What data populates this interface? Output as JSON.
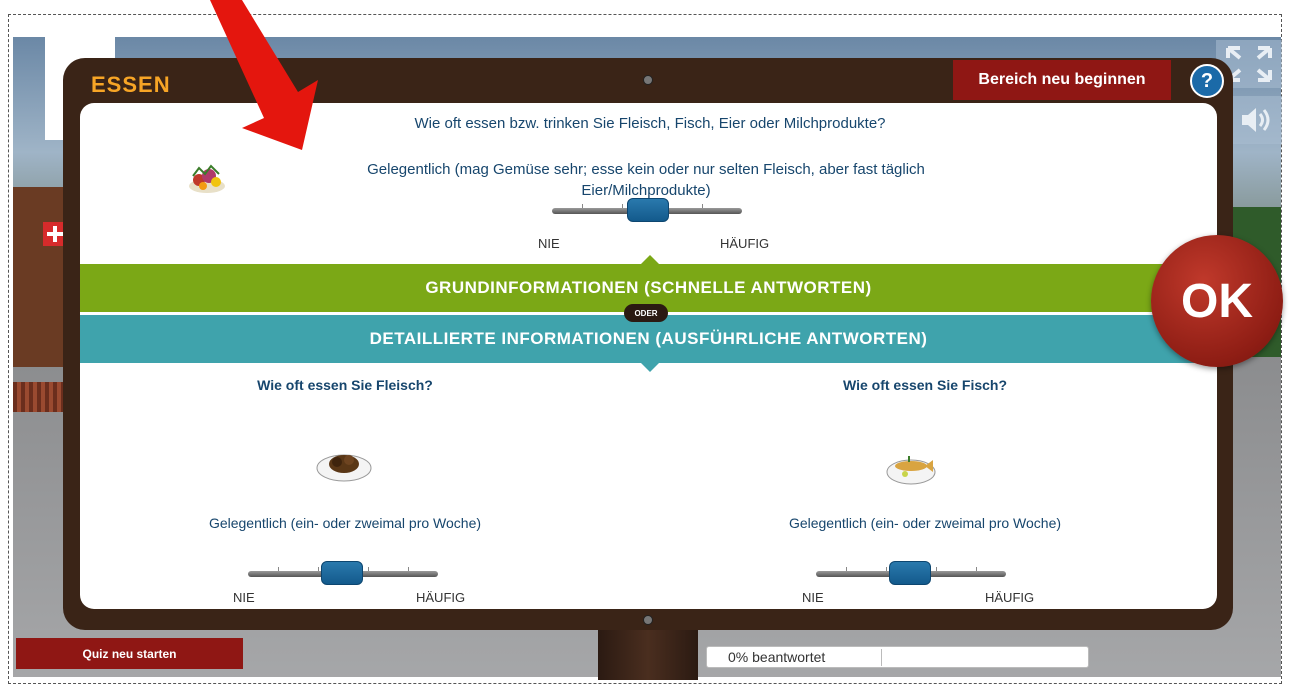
{
  "board": {
    "title": "ESSEN",
    "restart_area_label": "Bereich neu beginnen",
    "help_label": "?"
  },
  "main_question": {
    "text": "Wie oft essen bzw. trinken Sie Fleisch, Fisch, Eier oder Milchprodukte?",
    "answer": "Gelegentlich (mag Gemüse sehr; esse kein oder nur selten Fleisch, aber fast täglich Eier/Milchprodukte)",
    "slider_min_label": "NIE",
    "slider_max_label": "HÄUFIG",
    "slider_value": 0.5,
    "icon": "salad-plate-icon"
  },
  "bands": {
    "basic": "GRUNDINFORMATIONEN (SCHNELLE ANTWORTEN)",
    "or": "ODER",
    "detailed": "DETAILLIERTE INFORMATIONEN (AUSFÜHRLICHE ANTWORTEN)"
  },
  "detail_questions": [
    {
      "question": "Wie oft essen Sie Fleisch?",
      "answer": "Gelegentlich (ein- oder zweimal pro Woche)",
      "slider_min_label": "NIE",
      "slider_max_label": "HÄUFIG",
      "slider_value": 0.5,
      "icon": "meat-plate-icon"
    },
    {
      "question": "Wie oft essen Sie Fisch?",
      "answer": "Gelegentlich (ein- oder zweimal pro Woche)",
      "slider_min_label": "NIE",
      "slider_max_label": "HÄUFIG",
      "slider_value": 0.5,
      "icon": "fish-plate-icon"
    }
  ],
  "ok_label": "OK",
  "footer": {
    "quiz_restart_label": "Quiz neu starten",
    "progress_text": "0% beantwortet",
    "progress_value": 0
  },
  "controls": {
    "fullscreen_icon": "fullscreen-icon",
    "sound_icon": "speaker-icon"
  },
  "colors": {
    "title": "#f7a526",
    "question_text": "#17466d",
    "band_green": "#7ba816",
    "band_teal": "#3fa3ac",
    "button_red": "#8f1714",
    "help_blue": "#1b6aa8",
    "board": "#3a2417"
  }
}
